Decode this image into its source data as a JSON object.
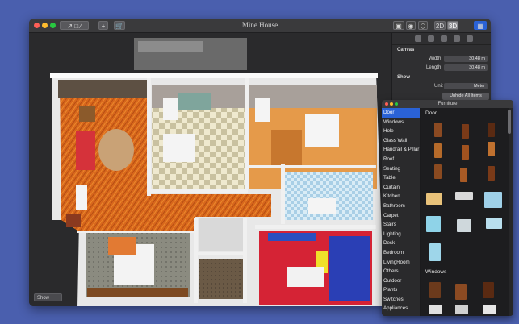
{
  "window": {
    "title": "Mine House",
    "toolbar": {
      "view_2d": "2D",
      "view_3d": "3D"
    }
  },
  "inspector": {
    "canvas_heading": "Canvas",
    "width_label": "Width",
    "width_value": "30.48 m",
    "length_label": "Length",
    "length_value": "30.48 m",
    "show_heading": "Show",
    "unit_label": "Unit",
    "unit_value": "Meter",
    "unhide_button": "Unhide All Items"
  },
  "furniture_panel": {
    "title": "Furniture",
    "categories": [
      "Door",
      "Windows",
      "Hole",
      "Glass Wall",
      "Handrail & Pillar",
      "Roof",
      "Seating",
      "Table",
      "Curtain",
      "Kitchen",
      "Bathroom",
      "Carpet",
      "Stairs",
      "Lighting",
      "Desk",
      "Bedroom",
      "LivingRoom",
      "Others",
      "Outdoor",
      "Plants",
      "Switches",
      "Appliances"
    ],
    "selected_category": "Door",
    "section_door": "Door",
    "section_windows": "Windows"
  },
  "bottom_bar": {
    "show_select": "Show"
  },
  "colors": {
    "accent": "#2a62d6",
    "background": "#4a5fae"
  }
}
